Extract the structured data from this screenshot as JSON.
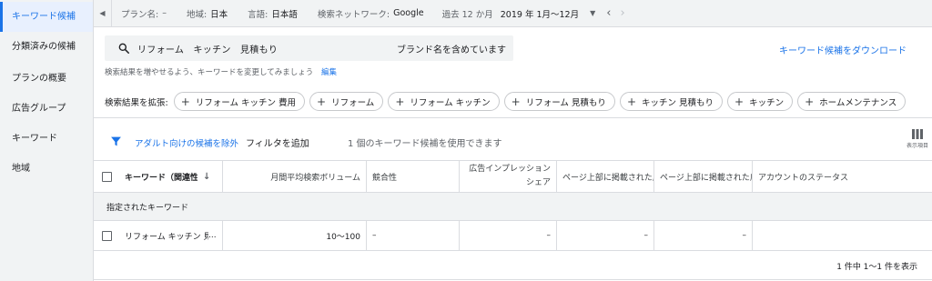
{
  "sidebar": {
    "items": [
      {
        "label": "キーワード候補",
        "active": true
      },
      {
        "label": "分類済みの候補",
        "active": false
      },
      {
        "label": "プランの概要",
        "active": false
      },
      {
        "label": "広告グループ",
        "active": false
      },
      {
        "label": "キーワード",
        "active": false
      },
      {
        "label": "地域",
        "active": false
      }
    ]
  },
  "topbar": {
    "plan_label": "プラン名:",
    "plan_value": "–",
    "location_label": "地域:",
    "location_value": "日本",
    "language_label": "言語:",
    "language_value": "日本語",
    "network_label": "検索ネットワーク:",
    "network_value": "Google",
    "period_label": "過去 12 か月",
    "period_range": "2019 年 1月〜12月"
  },
  "search": {
    "query": "リフォーム　キッチン　見積もり",
    "brand_note": "ブランド名を含めています",
    "download_label": "キーワード候補をダウンロード",
    "hint": "検索結果を増やせるよう、キーワードを変更してみましょう",
    "edit_label": "編集"
  },
  "expand": {
    "label": "検索結果を拡張:",
    "chips": [
      "リフォーム キッチン 費用",
      "リフォーム",
      "リフォーム キッチン",
      "リフォーム 見積もり",
      "キッチン 見積もり",
      "キッチン",
      "ホームメンテナンス"
    ]
  },
  "filter": {
    "adult_label": "アダルト向けの候補を除外",
    "add_filter_label": "フィルタを追加",
    "count_note": "1 個のキーワード候補を使用できます",
    "columns_label": "表示項目"
  },
  "table": {
    "headers": {
      "keyword": "キーワード（関連性によって並べ替え）",
      "volume": "月間平均検索ボリューム",
      "competition": "競合性",
      "impression_share": "広告インプレッション\nシェア",
      "top_low": "ページ上部に掲載された広告の入札単価（低額帯）",
      "top_high": "ページ上部に掲載された広告の入札単価（高額帯）",
      "status": "アカウントのステータス"
    },
    "section_label": "指定されたキーワード",
    "rows": [
      {
        "keyword": "リフォーム キッチン 見積もり",
        "volume": "10〜100",
        "competition": "–",
        "impression_share": "–",
        "top_low": "–",
        "top_high": "–",
        "status": ""
      }
    ],
    "pager": "1 件中 1〜1 件を表示"
  }
}
